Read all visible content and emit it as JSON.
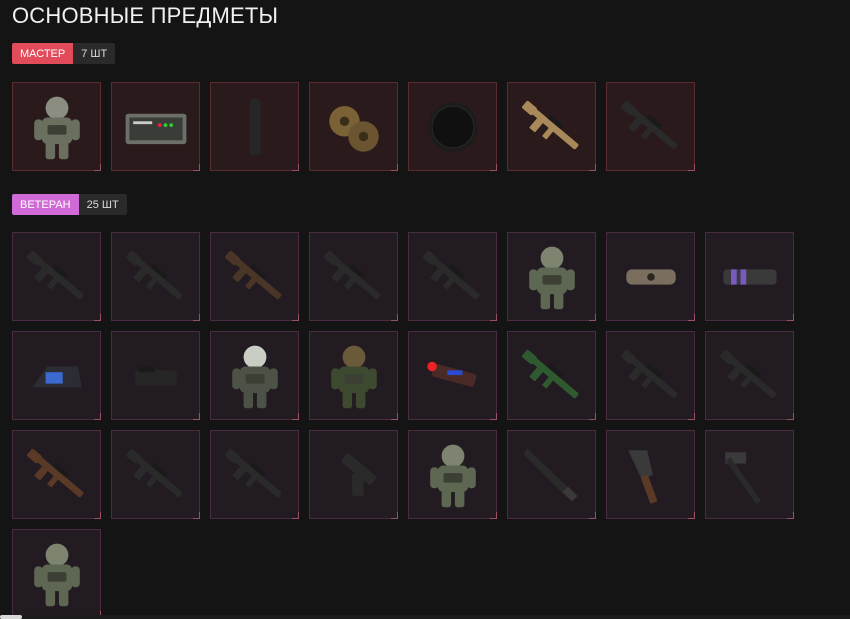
{
  "page": {
    "title": "ОСНОВНЫЕ ПРЕДМЕТЫ"
  },
  "tiers": {
    "master": {
      "label": "МАСТЕР",
      "count": "7 ШТ",
      "color": "#e24b5a",
      "items": [
        {
          "icon": "heavy-armor-suit"
        },
        {
          "icon": "ammo-crate"
        },
        {
          "icon": "suppressor"
        },
        {
          "icon": "double-drum-magazine"
        },
        {
          "icon": "drum-magazine"
        },
        {
          "icon": "tan-assault-rifle"
        },
        {
          "icon": "black-assault-rifle"
        }
      ]
    },
    "veteran": {
      "label": "ВЕТЕРАН",
      "count": "25 ШТ",
      "color": "#d06ad6",
      "items": [
        {
          "icon": "assault-rifle"
        },
        {
          "icon": "assault-rifle"
        },
        {
          "icon": "sniper-rifle"
        },
        {
          "icon": "assault-rifle"
        },
        {
          "icon": "rifle"
        },
        {
          "icon": "armor-suit"
        },
        {
          "icon": "rail-attachment"
        },
        {
          "icon": "muzzle-brake"
        },
        {
          "icon": "holographic-sight"
        },
        {
          "icon": "red-dot-sight"
        },
        {
          "icon": "exoskeleton-suit"
        },
        {
          "icon": "gasmask-suit"
        },
        {
          "icon": "laser-module"
        },
        {
          "icon": "green-sniper-rifle"
        },
        {
          "icon": "assault-rifle"
        },
        {
          "icon": "assault-rifle"
        },
        {
          "icon": "shotgun"
        },
        {
          "icon": "machine-gun"
        },
        {
          "icon": "assault-rifle"
        },
        {
          "icon": "pistol"
        },
        {
          "icon": "armor-suit"
        },
        {
          "icon": "machete"
        },
        {
          "icon": "cleaver"
        },
        {
          "icon": "tomahawk"
        },
        {
          "icon": "armor-suit"
        }
      ]
    }
  }
}
